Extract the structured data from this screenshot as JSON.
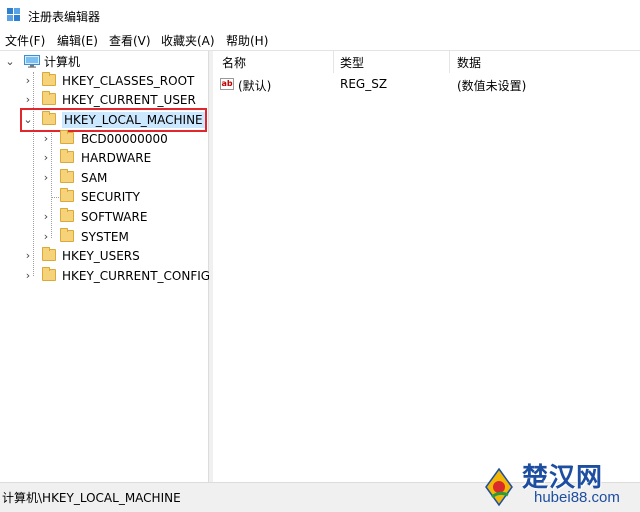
{
  "window": {
    "title": "注册表编辑器"
  },
  "menu": [
    "文件(F)",
    "编辑(E)",
    "查看(V)",
    "收藏夹(A)",
    "帮助(H)"
  ],
  "tree": {
    "root": "计算机",
    "hives": [
      {
        "label": "HKEY_CLASSES_ROOT"
      },
      {
        "label": "HKEY_CURRENT_USER"
      },
      {
        "label": "HKEY_LOCAL_MACHINE",
        "expanded": true,
        "selected": true,
        "children": [
          "BCD00000000",
          "HARDWARE",
          "SAM",
          "SECURITY",
          "SOFTWARE",
          "SYSTEM"
        ]
      },
      {
        "label": "HKEY_USERS"
      },
      {
        "label": "HKEY_CURRENT_CONFIG"
      }
    ]
  },
  "list": {
    "columns": [
      "名称",
      "类型",
      "数据"
    ],
    "rows": [
      {
        "name": "(默认)",
        "type": "REG_SZ",
        "data": "(数值未设置)"
      }
    ]
  },
  "status": {
    "path": "计算机\\HKEY_LOCAL_MACHINE"
  },
  "watermark": {
    "title": "楚汉网",
    "url": "hubei88.com"
  },
  "colors": {
    "highlight_box": "#e0282c",
    "folder": "#f6d37a",
    "watermark": "#1d4ea0"
  }
}
